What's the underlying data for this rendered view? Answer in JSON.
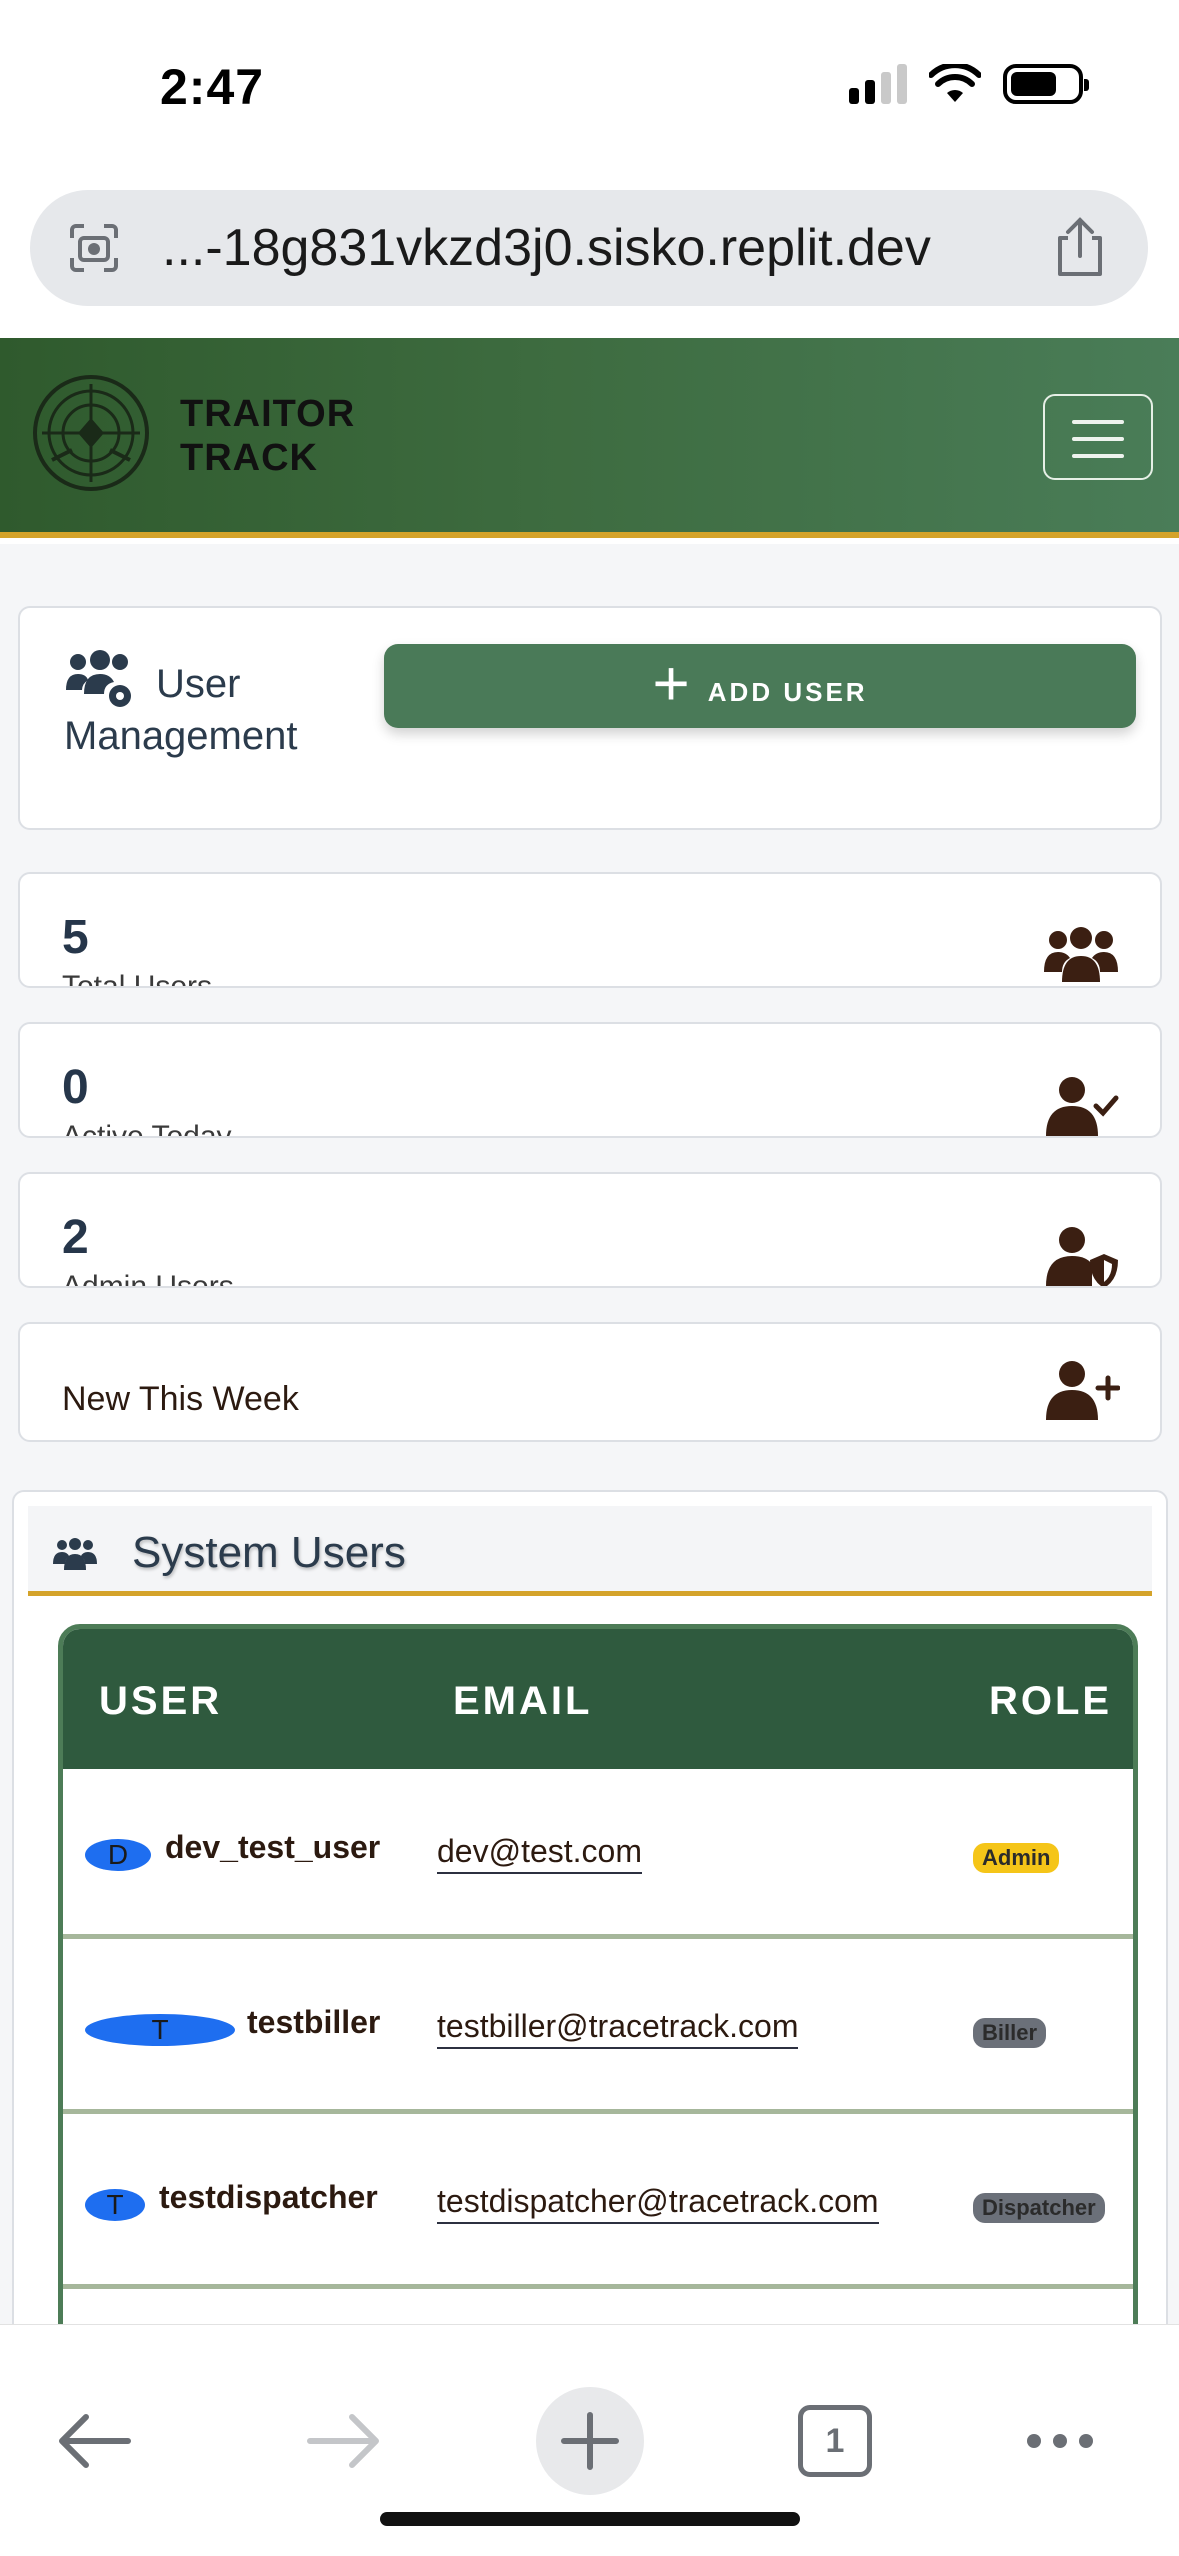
{
  "status_bar": {
    "time": "2:47"
  },
  "browser": {
    "url": "...-18g831vkzd3j0.sisko.replit.dev",
    "tab_count": "1"
  },
  "app": {
    "brand_line1": "TRAITOR",
    "brand_line2": "TRACK"
  },
  "user_management": {
    "title_line1": "User",
    "title_line2": "Management",
    "add_button_label": "ADD USER"
  },
  "stats": [
    {
      "value": "5",
      "caption": "Total Users",
      "icon": "users-icon"
    },
    {
      "value": "0",
      "caption": "Active Today",
      "icon": "user-check-icon"
    },
    {
      "value": "2",
      "caption": "Admin Users",
      "icon": "user-shield-icon"
    },
    {
      "value": "",
      "caption": "New This Week",
      "icon": "user-plus-icon"
    }
  ],
  "system_users": {
    "title": "System Users",
    "columns": [
      "USER",
      "EMAIL",
      "ROLE"
    ],
    "rows": [
      {
        "initial": "D",
        "username": "dev_test_user",
        "email": "dev@test.com",
        "role": "Admin"
      },
      {
        "initial": "T",
        "username": "testbiller",
        "email": "testbiller@tracetrack.com",
        "role": "Biller"
      },
      {
        "initial": "T",
        "username": "testdispatcher",
        "email": "testdispatcher@tracetrack.com",
        "role": "Dispatcher"
      }
    ]
  },
  "colors": {
    "header_green": "#3d6b3f",
    "accent_gold": "#d4a32a",
    "button_green": "#4a7a58",
    "table_head_green": "#2f5a3e",
    "avatar_blue": "#1e6ef0",
    "admin_badge": "#f5c518",
    "role_badge_grey": "#6b7079"
  }
}
